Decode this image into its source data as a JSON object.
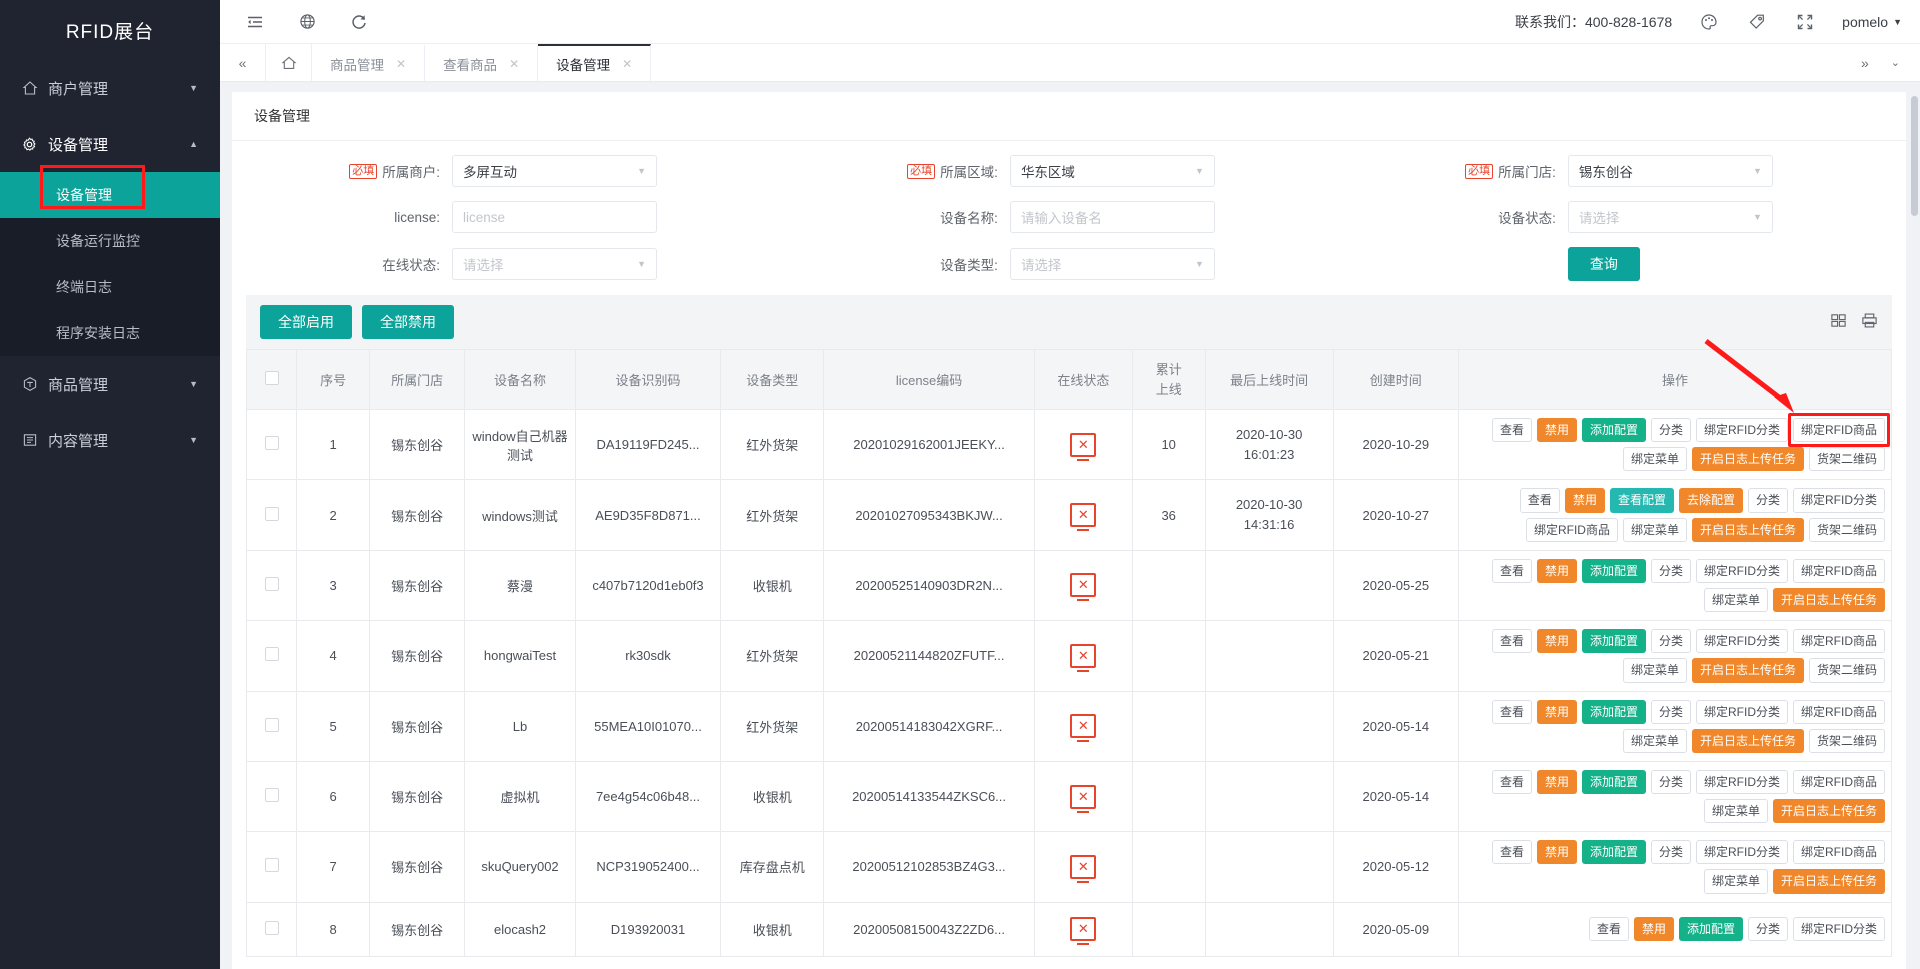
{
  "sidebar": {
    "logo": "RFID展台",
    "groups": [
      {
        "icon": "home-icon",
        "label": "商户管理",
        "open": false,
        "items": []
      },
      {
        "icon": "gear-icon",
        "label": "设备管理",
        "open": true,
        "items": [
          "设备管理",
          "设备运行监控",
          "终端日志",
          "程序安装日志"
        ],
        "active_item": "设备管理"
      },
      {
        "icon": "cube-icon",
        "label": "商品管理",
        "open": false,
        "items": []
      },
      {
        "icon": "content-icon",
        "label": "内容管理",
        "open": false,
        "items": []
      }
    ]
  },
  "topbar": {
    "icons": [
      "menu-fold-icon",
      "globe-icon",
      "refresh-icon"
    ],
    "contact": "联系我们：400-828-1678",
    "right_icons": [
      "palette-icon",
      "tag-icon",
      "fullscreen-icon"
    ],
    "user": "pomelo"
  },
  "tabbar": {
    "nav_left": "«",
    "home": "home-icon",
    "tabs": [
      {
        "label": "商品管理",
        "closable": true,
        "active": false
      },
      {
        "label": "查看商品",
        "closable": true,
        "active": false
      },
      {
        "label": "设备管理",
        "closable": true,
        "active": true
      }
    ],
    "right_icons": [
      "»",
      "chevron-down-icon"
    ]
  },
  "page": {
    "title": "设备管理"
  },
  "filters": {
    "required_badge": "必填",
    "rows": [
      [
        {
          "label": "所属商户:",
          "required": true,
          "value": "多屏互动",
          "type": "select"
        },
        {
          "label": "所属区域:",
          "required": true,
          "value": "华东区域",
          "type": "select"
        },
        {
          "label": "所属门店:",
          "required": true,
          "value": "锡东创谷",
          "type": "select"
        }
      ],
      [
        {
          "label": "license:",
          "required": false,
          "value": "",
          "placeholder": "license",
          "type": "input"
        },
        {
          "label": "设备名称:",
          "required": false,
          "value": "",
          "placeholder": "请输入设备名",
          "type": "input"
        },
        {
          "label": "设备状态:",
          "required": false,
          "value": "",
          "placeholder": "请选择",
          "type": "select"
        }
      ],
      [
        {
          "label": "在线状态:",
          "required": false,
          "value": "",
          "placeholder": "请选择",
          "type": "select"
        },
        {
          "label": "设备类型:",
          "required": false,
          "value": "",
          "placeholder": "请选择",
          "type": "select"
        },
        {
          "label": "",
          "required": false,
          "value": "",
          "type": "button",
          "button_label": "查询"
        }
      ]
    ],
    "query_label": "查询"
  },
  "toolbar": {
    "enable_all": "全部启用",
    "disable_all": "全部禁用",
    "right_icons": [
      "columns-icon",
      "print-icon"
    ]
  },
  "table": {
    "columns": [
      "",
      "序号",
      "所属门店",
      "设备名称",
      "设备识别码",
      "设备类型",
      "license编码",
      "在线状态",
      "累计上线",
      "最后上线时间",
      "创建时间",
      "操作"
    ],
    "col_offline_header_line1": "累计",
    "col_offline_header_line2": "上线",
    "status_icon": "offline-monitor-icon",
    "rows": [
      {
        "no": "1",
        "store": "锡东创谷",
        "name": "window自己机器测试",
        "code": "DA19119FD245...",
        "type": "红外货架",
        "license": "20201029162001JEEKY...",
        "online": "offline",
        "total": "10",
        "last_online_date": "2020-10-30",
        "last_online_time": "16:01:23",
        "created": "2020-10-29",
        "ops": [
          {
            "label": "查看",
            "style": "ghost"
          },
          {
            "label": "禁用",
            "style": "orange"
          },
          {
            "label": "添加配置",
            "style": "green"
          },
          {
            "label": "分类",
            "style": "ghost"
          },
          {
            "label": "绑定RFID分类",
            "style": "ghost"
          },
          {
            "label": "绑定RFID商品",
            "style": "ghost",
            "highlight": true
          },
          {
            "label": "绑定菜单",
            "style": "ghost"
          },
          {
            "label": "开启日志上传任务",
            "style": "orange"
          },
          {
            "label": "货架二维码",
            "style": "ghost"
          }
        ]
      },
      {
        "no": "2",
        "store": "锡东创谷",
        "name": "windows测试",
        "code": "AE9D35F8D871...",
        "type": "红外货架",
        "license": "20201027095343BKJW...",
        "online": "offline",
        "total": "36",
        "last_online_date": "2020-10-30",
        "last_online_time": "14:31:16",
        "created": "2020-10-27",
        "ops": [
          {
            "label": "查看",
            "style": "ghost"
          },
          {
            "label": "禁用",
            "style": "orange"
          },
          {
            "label": "查看配置",
            "style": "teal2"
          },
          {
            "label": "去除配置",
            "style": "orange"
          },
          {
            "label": "分类",
            "style": "ghost"
          },
          {
            "label": "绑定RFID分类",
            "style": "ghost"
          },
          {
            "label": "绑定RFID商品",
            "style": "ghost"
          },
          {
            "label": "绑定菜单",
            "style": "ghost"
          },
          {
            "label": "开启日志上传任务",
            "style": "orange"
          },
          {
            "label": "货架二维码",
            "style": "ghost"
          }
        ]
      },
      {
        "no": "3",
        "store": "锡东创谷",
        "name": "蔡漫",
        "code": "c407b7120d1eb0f3",
        "type": "收银机",
        "license": "20200525140903DR2N...",
        "online": "offline",
        "total": "",
        "last_online_date": "",
        "last_online_time": "",
        "created": "2020-05-25",
        "ops": [
          {
            "label": "查看",
            "style": "ghost"
          },
          {
            "label": "禁用",
            "style": "orange"
          },
          {
            "label": "添加配置",
            "style": "green"
          },
          {
            "label": "分类",
            "style": "ghost"
          },
          {
            "label": "绑定RFID分类",
            "style": "ghost"
          },
          {
            "label": "绑定RFID商品",
            "style": "ghost"
          },
          {
            "label": "绑定菜单",
            "style": "ghost"
          },
          {
            "label": "开启日志上传任务",
            "style": "orange"
          }
        ]
      },
      {
        "no": "4",
        "store": "锡东创谷",
        "name": "hongwaiTest",
        "code": "rk30sdk",
        "type": "红外货架",
        "license": "20200521144820ZFUTF...",
        "online": "offline",
        "total": "",
        "last_online_date": "",
        "last_online_time": "",
        "created": "2020-05-21",
        "ops": [
          {
            "label": "查看",
            "style": "ghost"
          },
          {
            "label": "禁用",
            "style": "orange"
          },
          {
            "label": "添加配置",
            "style": "green"
          },
          {
            "label": "分类",
            "style": "ghost"
          },
          {
            "label": "绑定RFID分类",
            "style": "ghost"
          },
          {
            "label": "绑定RFID商品",
            "style": "ghost"
          },
          {
            "label": "绑定菜单",
            "style": "ghost"
          },
          {
            "label": "开启日志上传任务",
            "style": "orange"
          },
          {
            "label": "货架二维码",
            "style": "ghost"
          }
        ]
      },
      {
        "no": "5",
        "store": "锡东创谷",
        "name": "Lb",
        "code": "55MEA10I01070...",
        "type": "红外货架",
        "license": "20200514183042XGRF...",
        "online": "offline",
        "total": "",
        "last_online_date": "",
        "last_online_time": "",
        "created": "2020-05-14",
        "ops": [
          {
            "label": "查看",
            "style": "ghost"
          },
          {
            "label": "禁用",
            "style": "orange"
          },
          {
            "label": "添加配置",
            "style": "green"
          },
          {
            "label": "分类",
            "style": "ghost"
          },
          {
            "label": "绑定RFID分类",
            "style": "ghost"
          },
          {
            "label": "绑定RFID商品",
            "style": "ghost"
          },
          {
            "label": "绑定菜单",
            "style": "ghost"
          },
          {
            "label": "开启日志上传任务",
            "style": "orange"
          },
          {
            "label": "货架二维码",
            "style": "ghost"
          }
        ]
      },
      {
        "no": "6",
        "store": "锡东创谷",
        "name": "虚拟机",
        "code": "7ee4g54c06b48...",
        "type": "收银机",
        "license": "20200514133544ZKSC6...",
        "online": "offline",
        "total": "",
        "last_online_date": "",
        "last_online_time": "",
        "created": "2020-05-14",
        "ops": [
          {
            "label": "查看",
            "style": "ghost"
          },
          {
            "label": "禁用",
            "style": "orange"
          },
          {
            "label": "添加配置",
            "style": "green"
          },
          {
            "label": "分类",
            "style": "ghost"
          },
          {
            "label": "绑定RFID分类",
            "style": "ghost"
          },
          {
            "label": "绑定RFID商品",
            "style": "ghost"
          },
          {
            "label": "绑定菜单",
            "style": "ghost"
          },
          {
            "label": "开启日志上传任务",
            "style": "orange"
          }
        ]
      },
      {
        "no": "7",
        "store": "锡东创谷",
        "name": "skuQuery002",
        "code": "NCP319052400...",
        "type": "库存盘点机",
        "license": "20200512102853BZ4G3...",
        "online": "offline",
        "total": "",
        "last_online_date": "",
        "last_online_time": "",
        "created": "2020-05-12",
        "ops": [
          {
            "label": "查看",
            "style": "ghost"
          },
          {
            "label": "禁用",
            "style": "orange"
          },
          {
            "label": "添加配置",
            "style": "green"
          },
          {
            "label": "分类",
            "style": "ghost"
          },
          {
            "label": "绑定RFID分类",
            "style": "ghost"
          },
          {
            "label": "绑定RFID商品",
            "style": "ghost"
          },
          {
            "label": "绑定菜单",
            "style": "ghost"
          },
          {
            "label": "开启日志上传任务",
            "style": "orange"
          }
        ]
      },
      {
        "no": "8",
        "store": "锡东创谷",
        "name": "elocash2",
        "code": "D193920031",
        "type": "收银机",
        "license": "20200508150043Z2ZD6...",
        "online": "offline",
        "total": "",
        "last_online_date": "",
        "last_online_time": "",
        "created": "2020-05-09",
        "ops": [
          {
            "label": "查看",
            "style": "ghost"
          },
          {
            "label": "禁用",
            "style": "orange"
          },
          {
            "label": "添加配置",
            "style": "green"
          },
          {
            "label": "分类",
            "style": "ghost"
          },
          {
            "label": "绑定RFID分类",
            "style": "ghost"
          }
        ]
      }
    ]
  },
  "colors": {
    "teal": "#0ba39a",
    "orange": "#f0882b",
    "green": "#15b28a",
    "red": "#e8442c",
    "sidebar": "#1f2430",
    "annotation": "#ff1a1a"
  }
}
